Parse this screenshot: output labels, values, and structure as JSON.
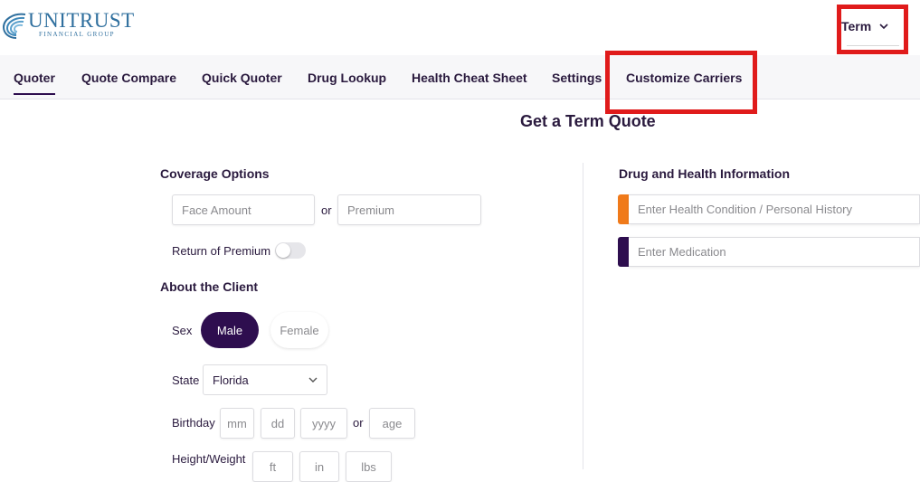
{
  "brand": {
    "name": "UNITRUST",
    "sub": "FINANCIAL GROUP"
  },
  "product_select": {
    "value": "Term"
  },
  "nav": {
    "tabs": [
      "Quoter",
      "Quote Compare",
      "Quick Quoter",
      "Drug Lookup",
      "Health Cheat Sheet",
      "Settings",
      "Customize Carriers"
    ],
    "active": "Quoter"
  },
  "page": {
    "title": "Get a Term Quote"
  },
  "coverage": {
    "heading": "Coverage Options",
    "face_amount_placeholder": "Face Amount",
    "or": "or",
    "premium_placeholder": "Premium",
    "rop_label": "Return of Premium",
    "rop_on": false
  },
  "client": {
    "heading": "About the Client",
    "sex_label": "Sex",
    "male": "Male",
    "female": "Female",
    "selected_sex": "Male",
    "state_label": "State",
    "state_value": "Florida",
    "birthday_label": "Birthday",
    "mm": "mm",
    "dd": "dd",
    "yyyy": "yyyy",
    "or": "or",
    "age": "age",
    "hw_label": "Height/Weight",
    "ft": "ft",
    "in": "in",
    "lbs": "lbs"
  },
  "health": {
    "heading": "Drug and Health Information",
    "condition_placeholder": "Enter Health Condition / Personal History",
    "medication_placeholder": "Enter Medication",
    "condition_color": "#f07a1a",
    "medication_color": "#2e0e4f"
  },
  "colors": {
    "primary": "#2e0e4f",
    "highlight": "#e01b1b"
  }
}
